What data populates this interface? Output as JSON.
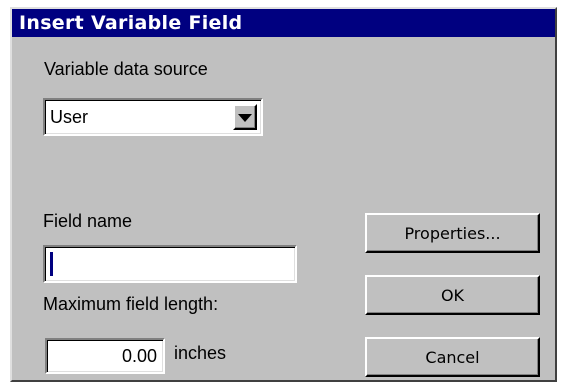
{
  "dialog": {
    "title": "Insert Variable Field"
  },
  "data_source": {
    "label": "Variable data source",
    "selected": "User",
    "arrow_icon": "dropdown-arrow-icon"
  },
  "field_name": {
    "label": "Field name",
    "value": ""
  },
  "max_length": {
    "label": "Maximum field length:",
    "value": "0.00",
    "unit": "inches"
  },
  "buttons": {
    "properties": "Properties...",
    "ok": "OK",
    "cancel": "Cancel"
  },
  "colors": {
    "titlebar": "#000080",
    "dialog_face": "#c0c0c0",
    "field_bg": "#ffffff"
  }
}
